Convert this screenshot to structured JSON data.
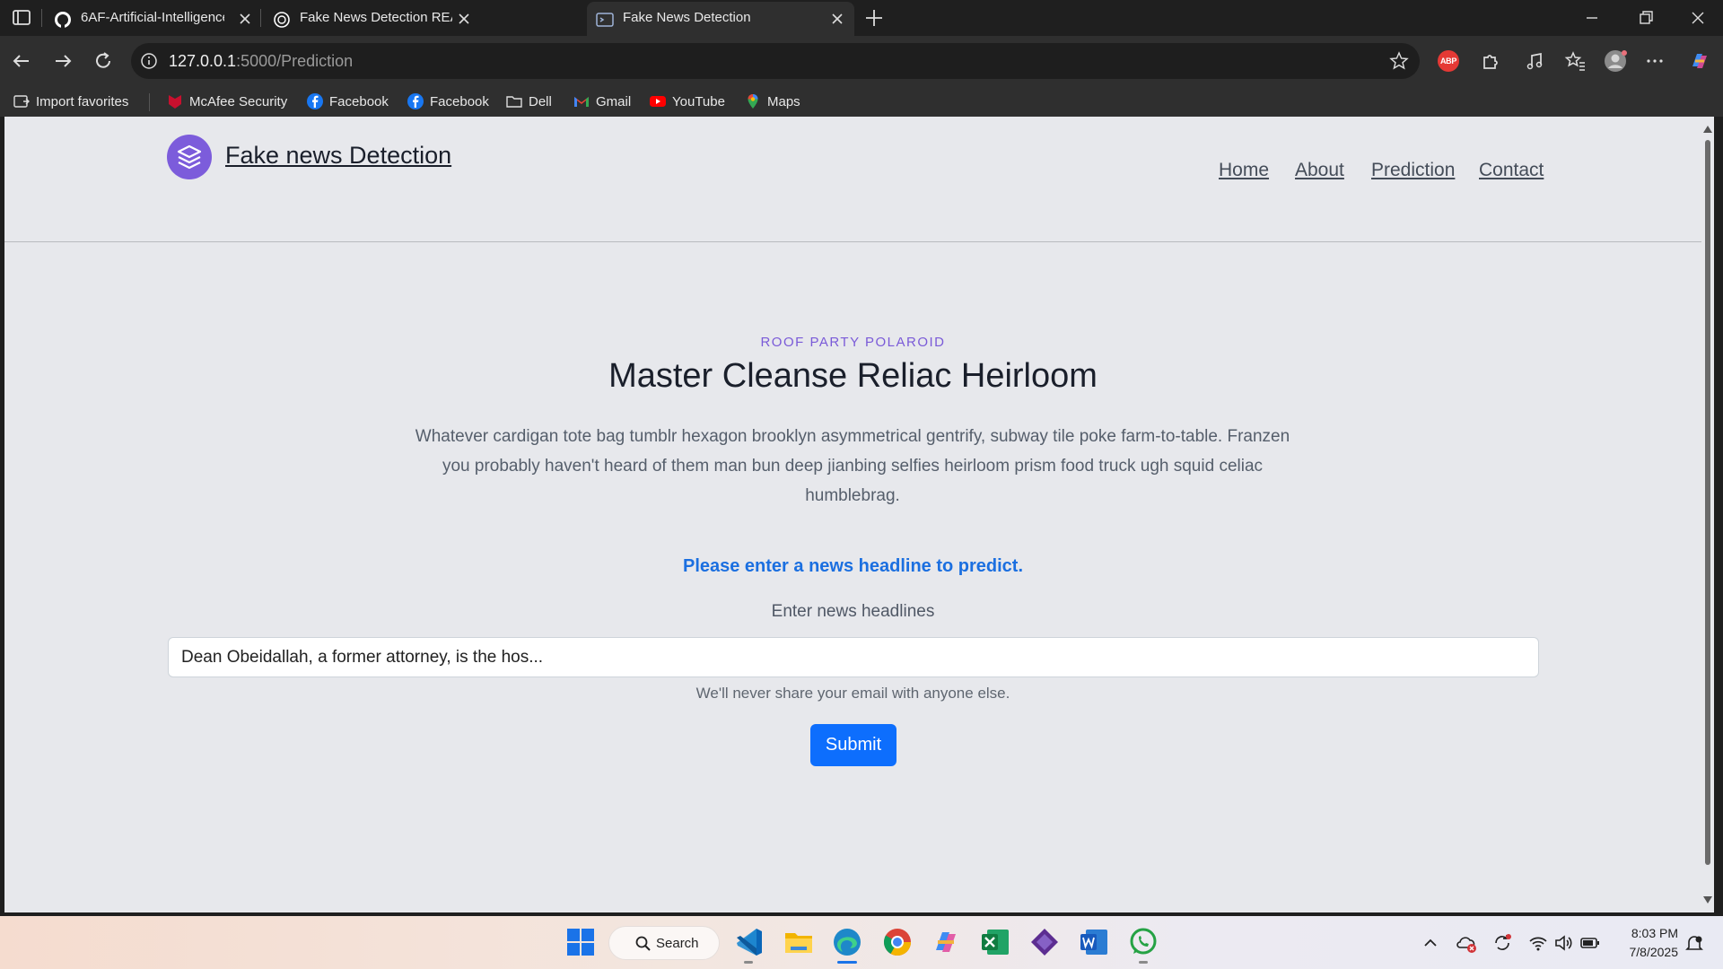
{
  "browser": {
    "tabs": [
      {
        "title": "6AF-Artificial-Intelligence-LAB_CS",
        "icon": "github-icon",
        "active": false
      },
      {
        "title": "Fake News Detection README",
        "icon": "openai-icon",
        "active": false
      },
      {
        "title": "Fake News Detection",
        "icon": "terminal-icon",
        "active": true
      }
    ],
    "url_host": "127.0.0.1",
    "url_path": ":5000/Prediction",
    "bookmarks": [
      {
        "label": "Import favorites",
        "icon": "import-icon"
      },
      {
        "label": "McAfee Security",
        "icon": "mcafee-icon"
      },
      {
        "label": "Facebook",
        "icon": "facebook-icon"
      },
      {
        "label": "Facebook",
        "icon": "facebook-icon"
      },
      {
        "label": "Dell",
        "icon": "folder-icon"
      },
      {
        "label": "Gmail",
        "icon": "gmail-icon"
      },
      {
        "label": "YouTube",
        "icon": "youtube-icon"
      },
      {
        "label": "Maps",
        "icon": "maps-icon"
      }
    ],
    "extension_abp": "ABP"
  },
  "site": {
    "brand": "Fake news Detection",
    "nav": [
      "Home",
      "About",
      "Prediction",
      "Contact"
    ],
    "eyebrow": "ROOF PARTY POLAROID",
    "heading": "Master Cleanse Reliac Heirloom",
    "lead": "Whatever cardigan tote bag tumblr hexagon brooklyn asymmetrical gentrify, subway tile poke farm-to-table. Franzen you probably haven't heard of them man bun deep jianbing selfies heirloom prism food truck ugh squid celiac humblebrag.",
    "prompt": "Please enter a news headline to predict.",
    "field_label": "Enter news headlines",
    "input_value": "Dean Obeidallah, a former attorney, is the hos...",
    "help_text": "We'll never share your email with anyone else.",
    "submit_label": "Submit"
  },
  "taskbar": {
    "search_label": "Search",
    "time": "8:03 PM",
    "date": "7/8/2025"
  },
  "colors": {
    "accent_purple": "#7c5cdb",
    "prompt_blue": "#1b6fe0",
    "submit_blue": "#0d6efd",
    "page_bg": "#e7e8ec"
  }
}
